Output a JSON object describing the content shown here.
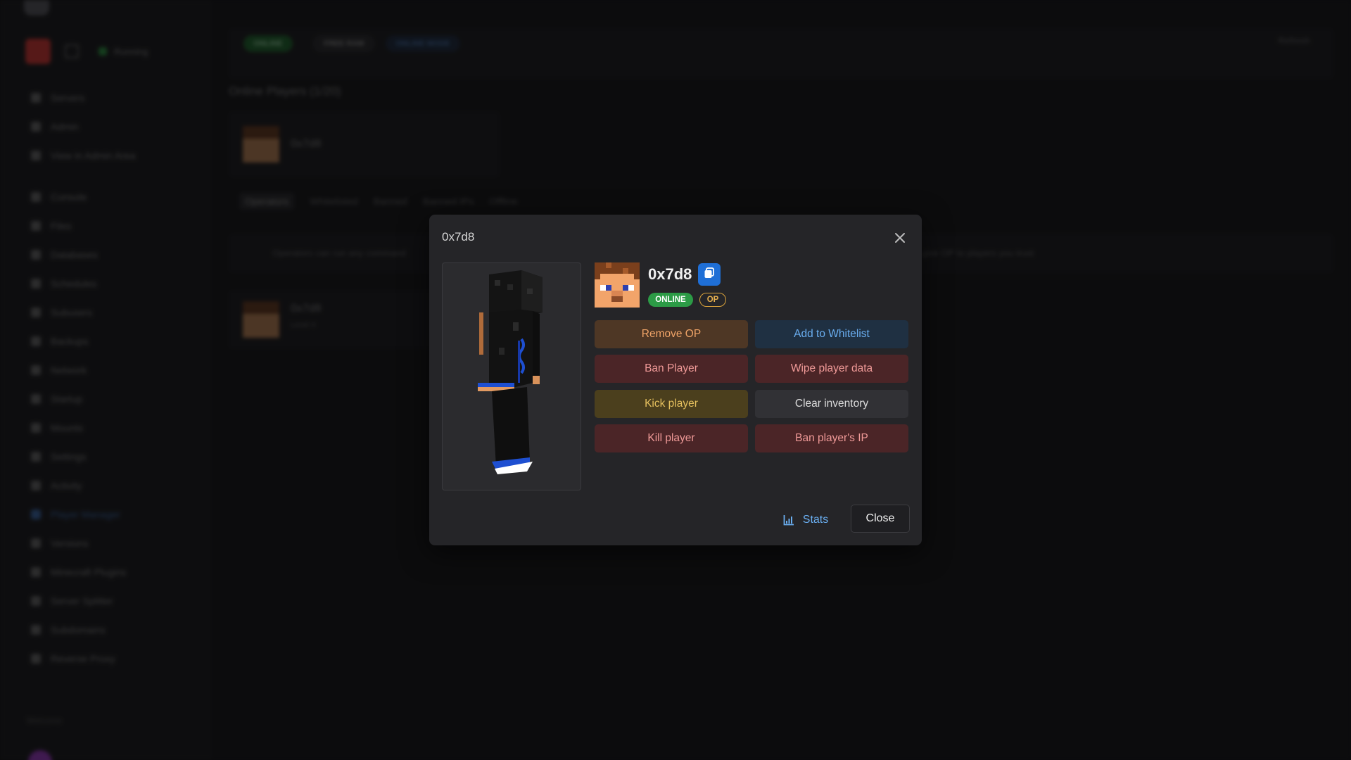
{
  "background": {
    "sidebar": {
      "status": "Running",
      "nav": [
        "Servers",
        "Admin",
        "View in Admin Area",
        "Console",
        "Files",
        "Databases",
        "Schedules",
        "Subusers",
        "Backups",
        "Network",
        "Startup",
        "Mounts",
        "Settings",
        "Activity",
        "Player Manager",
        "Versions",
        "Minecraft Plugins",
        "Server Splitter",
        "Subdomains",
        "Reverse Proxy"
      ],
      "active_index": 14,
      "footer": "Welcome"
    },
    "chips": {
      "online": "ONLINE",
      "free": "FREE RAM",
      "mode": "ONLINE MODE"
    },
    "top_right": "Refresh",
    "online_title": "Online Players (1/20)",
    "player_name": "0x7d8",
    "tabs": [
      "Operators",
      "Whitelisted",
      "Banned",
      "Banned IPs",
      "Offline"
    ],
    "info_left": "Operators can run any command",
    "info_right": "give OP to players you trust",
    "op_name": "0x7d8",
    "op_sub": "Level 4"
  },
  "modal": {
    "title": "0x7d8",
    "player_name": "0x7d8",
    "badges": {
      "online": "ONLINE",
      "op": "OP"
    },
    "actions": {
      "remove_op": "Remove OP",
      "add_whitelist": "Add to Whitelist",
      "ban_player": "Ban Player",
      "wipe_data": "Wipe player data",
      "kick_player": "Kick player",
      "clear_inventory": "Clear inventory",
      "kill_player": "Kill player",
      "ban_ip": "Ban player's IP"
    },
    "stats_label": "Stats",
    "close_label": "Close"
  },
  "colors": {
    "accent_blue": "#1f6fd6",
    "online_green": "#2c9b46",
    "op_gold": "#d9a23b",
    "danger_red": "#f09a98"
  },
  "icons": [
    "close-icon",
    "copy-icon",
    "stats-icon",
    "player-head-icon"
  ]
}
